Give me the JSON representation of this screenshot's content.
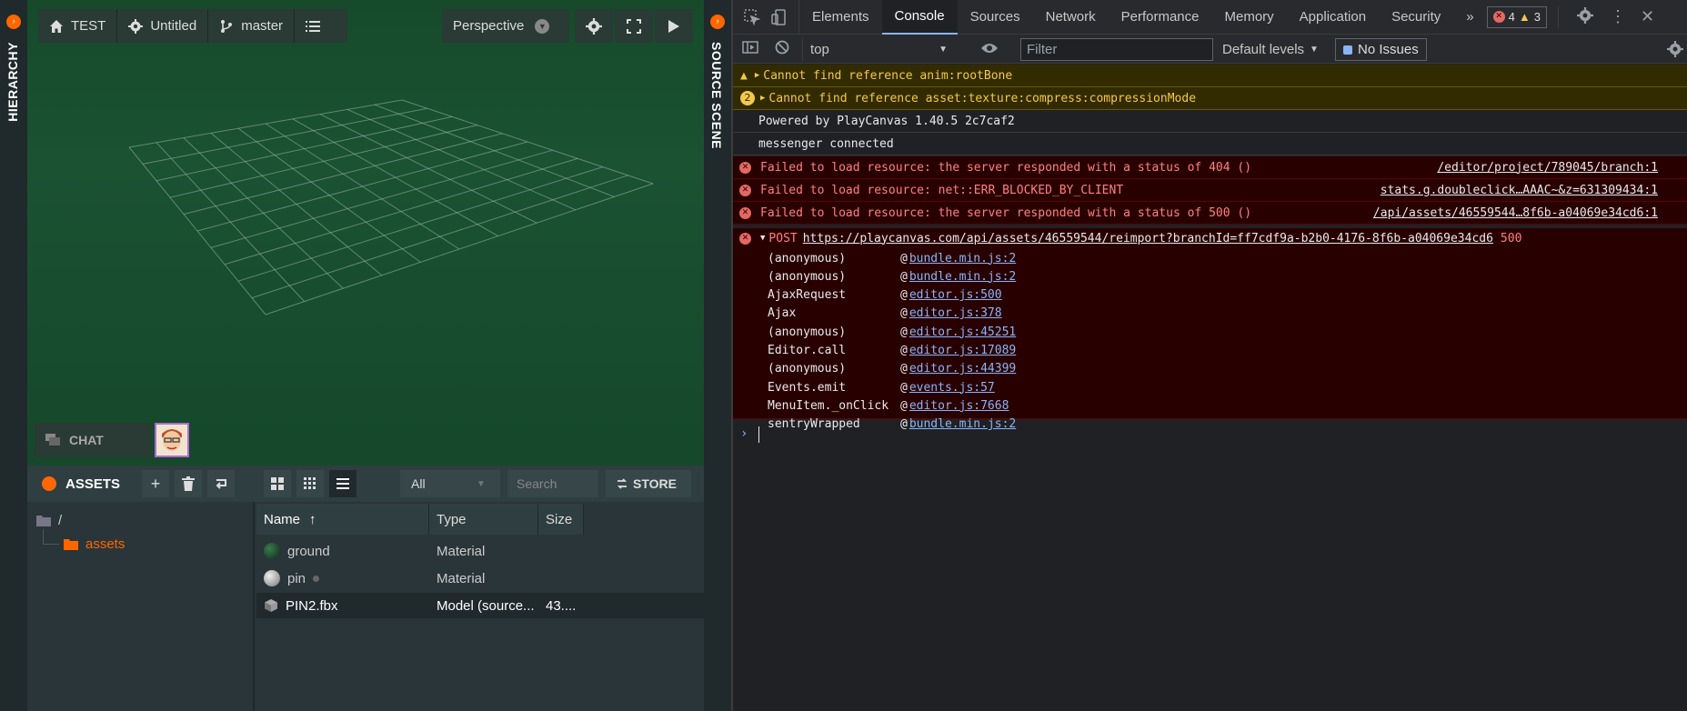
{
  "editor": {
    "hierarchy_label": "HIERARCHY",
    "source_scene_label": "SOURCE SCENE",
    "toolbar": {
      "project": "TEST",
      "scene": "Untitled",
      "branch": "master",
      "camera": "Perspective"
    },
    "chat_label": "CHAT",
    "assets": {
      "title": "ASSETS",
      "filter": "All",
      "search_placeholder": "Search",
      "store_label": "STORE",
      "tree": {
        "root": "/",
        "folder": "assets"
      },
      "columns": [
        "Name",
        "Type",
        "Size"
      ],
      "rows": [
        {
          "name": "ground",
          "type": "Material",
          "size": ""
        },
        {
          "name": "pin",
          "type": "Material",
          "size": ""
        },
        {
          "name": "PIN2.fbx",
          "type": "Model (source...",
          "size": "43...."
        }
      ]
    },
    "colors": {
      "accent": "#ff6600",
      "viewport": "#1a5232"
    }
  },
  "devtools": {
    "tabs": [
      "Elements",
      "Console",
      "Sources",
      "Network",
      "Performance",
      "Memory",
      "Application",
      "Security"
    ],
    "active_tab": "Console",
    "error_count": "4",
    "warning_count": "3",
    "context": "top",
    "filter_placeholder": "Filter",
    "levels": "Default levels",
    "issues": "No Issues",
    "messages": [
      {
        "level": "warn",
        "text": "Cannot find reference anim:rootBone",
        "count": "",
        "source": ""
      },
      {
        "level": "warn",
        "text": "Cannot find reference asset:texture:compress:compressionMode",
        "count": "2",
        "source": ""
      },
      {
        "level": "info",
        "text": "Powered by PlayCanvas 1.40.5 2c7caf2",
        "count": "",
        "source": ""
      },
      {
        "level": "info",
        "text": "messenger connected",
        "count": "",
        "source": ""
      },
      {
        "level": "err",
        "text": "Failed to load resource: the server responded with a status of 404 ()",
        "count": "",
        "source": "/editor/project/789045/branch:1"
      },
      {
        "level": "err",
        "text": "Failed to load resource: net::ERR_BLOCKED_BY_CLIENT",
        "count": "",
        "source": "stats.g.doubleclick…AAAC~&z=631309434:1"
      },
      {
        "level": "err",
        "text": "Failed to load resource: the server responded with a status of 500 ()",
        "count": "",
        "source": "/api/assets/46559544…8f6b-a04069e34cd6:1"
      }
    ],
    "post": {
      "method": "POST",
      "url": "https://playcanvas.com/api/assets/46559544/reimport?branchId=ff7cdf9a-b2b0-4176-8f6b-a04069e34cd6",
      "status": "500"
    },
    "stack": [
      {
        "fn": "(anonymous)",
        "loc": "bundle.min.js:2"
      },
      {
        "fn": "(anonymous)",
        "loc": "bundle.min.js:2"
      },
      {
        "fn": "AjaxRequest",
        "loc": "editor.js:500"
      },
      {
        "fn": "Ajax",
        "loc": "editor.js:378"
      },
      {
        "fn": "(anonymous)",
        "loc": "editor.js:45251"
      },
      {
        "fn": "Editor.call",
        "loc": "editor.js:17089"
      },
      {
        "fn": "(anonymous)",
        "loc": "editor.js:44399"
      },
      {
        "fn": "Events.emit",
        "loc": "events.js:57"
      },
      {
        "fn": "MenuItem._onClick",
        "loc": "editor.js:7668"
      },
      {
        "fn": "sentryWrapped",
        "loc": "bundle.min.js:2"
      }
    ]
  }
}
